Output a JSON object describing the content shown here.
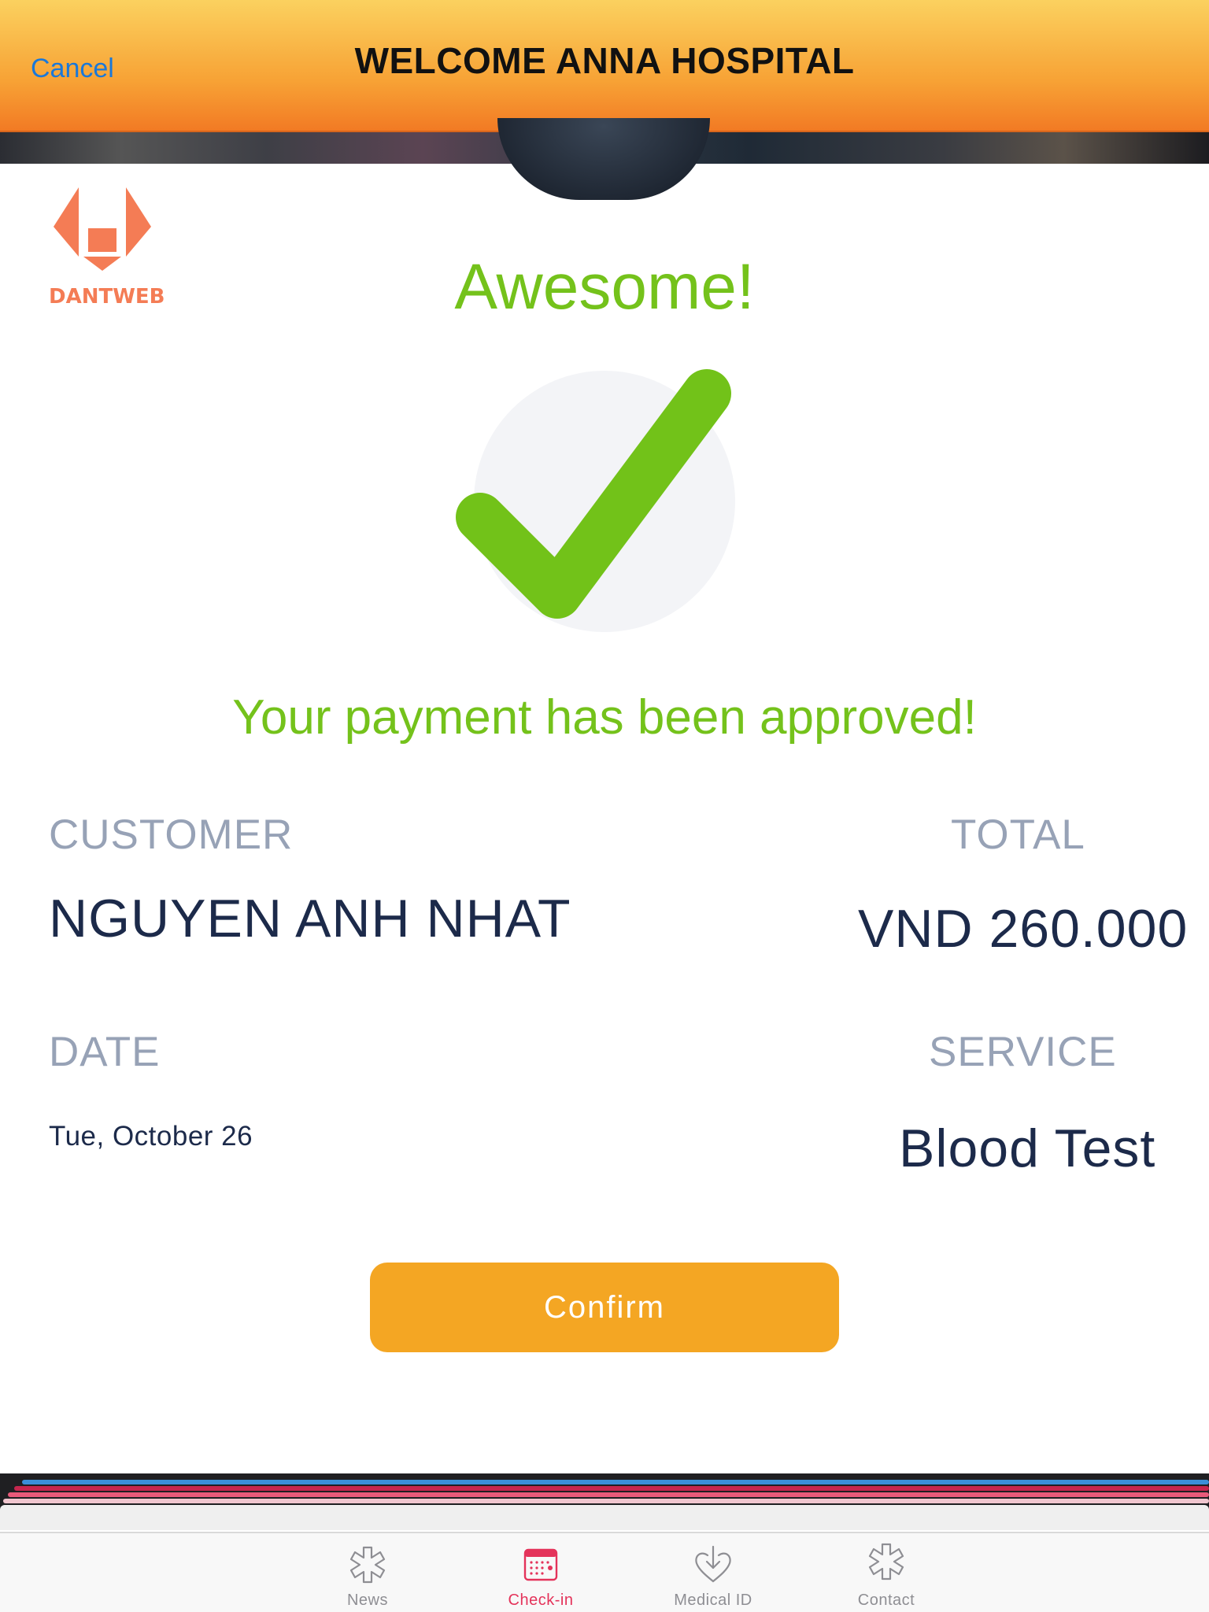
{
  "header": {
    "cancel_label": "Cancel",
    "title": "WELCOME ANNA HOSPITAL"
  },
  "logo": {
    "text": "DANTWEB",
    "color": "#f47c55"
  },
  "main": {
    "headline": "Awesome!",
    "status_message": "Your payment has been approved!",
    "customer_label": "CUSTOMER",
    "customer_value": "NGUYEN ANH NHAT",
    "total_label": "TOTAL",
    "total_value": "VND 260.000",
    "date_label": "DATE",
    "date_value": "Tue, October 26",
    "service_label": "SERVICE",
    "service_value": "Blood Test",
    "confirm_label": "Confirm"
  },
  "colors": {
    "accent_green": "#74c21b",
    "button_orange": "#f4a623",
    "cancel_blue": "#1a78d9",
    "active_tab": "#e4335a"
  },
  "tab_bar": {
    "items": [
      {
        "label": "News",
        "icon": "asterisk-icon",
        "active": false
      },
      {
        "label": "Check-in",
        "icon": "calendar-icon",
        "active": true
      },
      {
        "label": "Medical ID",
        "icon": "heart-download-icon",
        "active": false
      },
      {
        "label": "Contact",
        "icon": "asterisk-icon",
        "active": false
      }
    ]
  }
}
